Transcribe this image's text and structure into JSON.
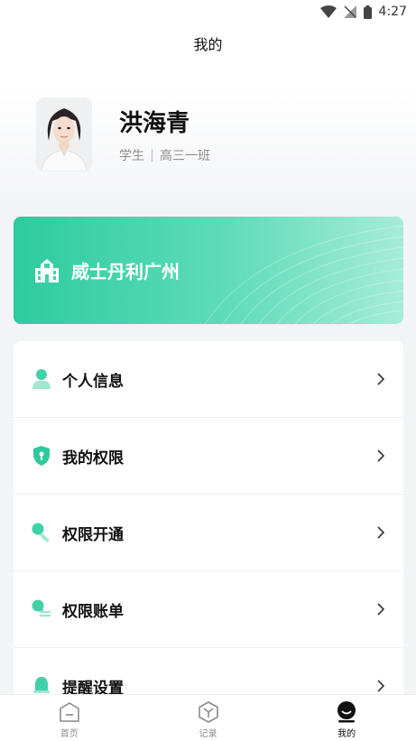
{
  "status": {
    "time": "4:27"
  },
  "header": {
    "title": "我的"
  },
  "profile": {
    "name": "洪海青",
    "role": "学生",
    "class": "高三一班"
  },
  "school": {
    "name": "威士丹利广州"
  },
  "menu": [
    {
      "label": "个人信息",
      "icon": "person-icon"
    },
    {
      "label": "我的权限",
      "icon": "shield-key-icon"
    },
    {
      "label": "权限开通",
      "icon": "key-icon"
    },
    {
      "label": "权限账单",
      "icon": "key-bill-icon"
    },
    {
      "label": "提醒设置",
      "icon": "bell-icon"
    }
  ],
  "tabs": [
    {
      "label": "首页",
      "icon": "home-icon"
    },
    {
      "label": "记录",
      "icon": "record-icon"
    },
    {
      "label": "我的",
      "icon": "profile-icon",
      "active": true
    }
  ],
  "colors": {
    "accent": "#2dcb9f",
    "accent_light": "#a6ecd7"
  }
}
